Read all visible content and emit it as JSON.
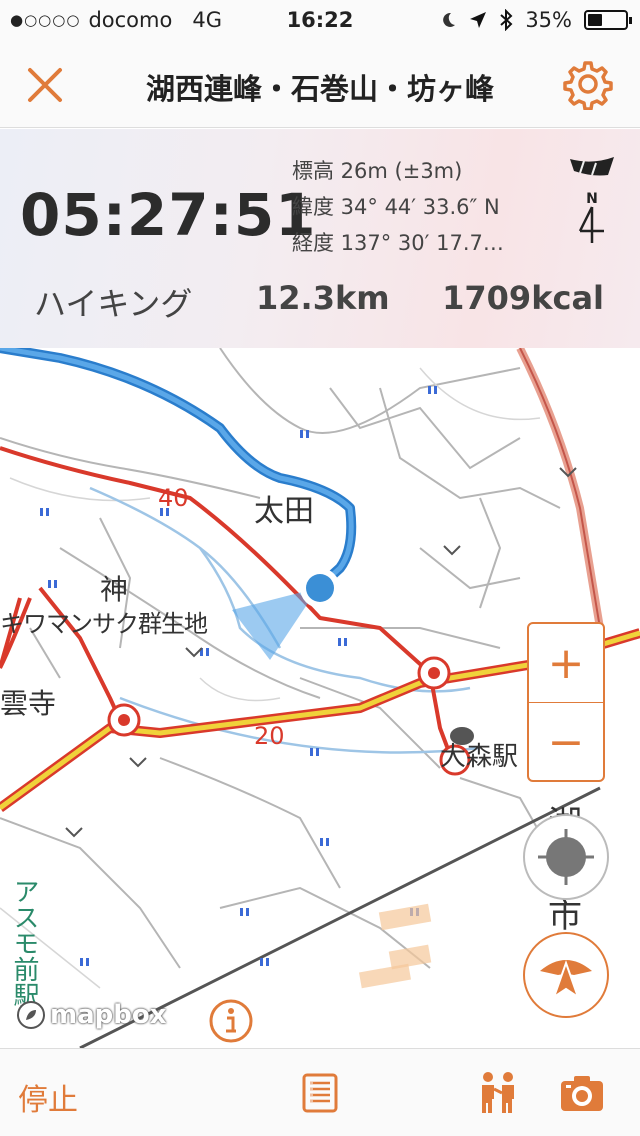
{
  "status_bar": {
    "signal": "●○○○○",
    "carrier": "docomo",
    "network": "4G",
    "time": "16:22",
    "battery": "35%"
  },
  "nav": {
    "title": "湖西連峰・石巻山・坊ヶ峰",
    "close_icon": "close-icon",
    "settings_icon": "gear-icon"
  },
  "stats": {
    "elapsed": "05:27:51",
    "elevation": "標高 26m (±3m)",
    "latitude": "緯度 34° 44′ 33.6″ N",
    "longitude": "経度 137° 30′ 17.7…",
    "activity": "ハイキング",
    "distance": "12.3km",
    "calories": "1709kcal",
    "compass_label": "N"
  },
  "map": {
    "labels": {
      "ota": "太田",
      "kami": "神",
      "gunsei": "キワマンサク群生地",
      "unji": "雲寺",
      "omori": "大森駅",
      "road40": "40",
      "road20": "20",
      "ko": "湖",
      "shi": "市",
      "asumo": "アスモ前駅"
    },
    "attribution": "mapbox",
    "zoom_in": "+",
    "zoom_out": "−",
    "colors": {
      "accent": "#e07b3a",
      "track": "#3b8fd6",
      "road": "#d9392b",
      "highway": "#f0d23a"
    }
  },
  "tabbar": {
    "stop_label": "停止",
    "list_icon": "list-icon",
    "people_icon": "hikers-icon",
    "camera_icon": "camera-icon"
  }
}
